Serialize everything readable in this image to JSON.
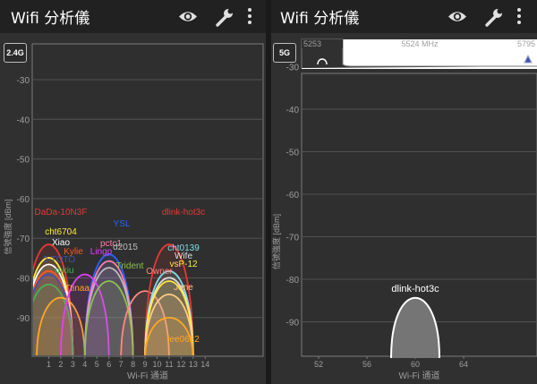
{
  "app": {
    "title": "Wifi 分析儀"
  },
  "left_panel": {
    "band_label": "2.4G",
    "y_axis_title": "信號強度 [dBm]",
    "x_axis_title": "Wi-Fi 通道",
    "y_ticks": [
      "-30",
      "-40",
      "-50",
      "-60",
      "-70",
      "-80",
      "-90"
    ],
    "x_ticks": [
      "1",
      "2",
      "3",
      "4",
      "5",
      "6",
      "7",
      "8",
      "9",
      "10",
      "11",
      "12",
      "13",
      "14"
    ],
    "networks": [
      {
        "name": "DaDa-10N3F",
        "channel": 1,
        "dbm": -66,
        "color": "#e53935"
      },
      {
        "name": "cht6704",
        "channel": 1,
        "dbm": -70,
        "color": "#ffeb3b"
      },
      {
        "name": "Xiao",
        "channel": 1,
        "dbm": -72,
        "color": "#ffffff"
      },
      {
        "name": "Kylie",
        "channel": 1,
        "dbm": -74,
        "color": "#ff5722"
      },
      {
        "name": "2-TOTO",
        "channel": 1,
        "dbm": -75,
        "color": "#3f51b5"
      },
      {
        "name": "mkiu",
        "channel": 1,
        "dbm": -78,
        "color": "#4caf50"
      },
      {
        "name": "Ttinaa",
        "channel": 2,
        "dbm": -82,
        "color": "#ffa726"
      },
      {
        "name": "YSL",
        "channel": 6,
        "dbm": -69,
        "color": "#2962ff"
      },
      {
        "name": "pctc1",
        "channel": 6,
        "dbm": -71,
        "color": "#ff80ab"
      },
      {
        "name": "d2015",
        "channel": 6,
        "dbm": -73,
        "color": "#bdbdbd"
      },
      {
        "name": "Lingp",
        "channel": 4,
        "dbm": -75,
        "color": "#e040fb"
      },
      {
        "name": "Trident",
        "channel": 6,
        "dbm": -77,
        "color": "#8bc34a"
      },
      {
        "name": "Owner",
        "channel": 9,
        "dbm": -80,
        "color": "#ff8a80"
      },
      {
        "name": "dlink-hot3c",
        "channel": 11,
        "dbm": -66,
        "color": "#e53935"
      },
      {
        "name": "cht0139",
        "channel": 11,
        "dbm": -74,
        "color": "#80deea"
      },
      {
        "name": "Wife",
        "channel": 11,
        "dbm": -76,
        "color": "#e0e0e0"
      },
      {
        "name": "vsP-12",
        "channel": 11,
        "dbm": -77,
        "color": "#ffeb3b"
      },
      {
        "name": "Jane",
        "channel": 11,
        "dbm": -81,
        "color": "#ffcc80"
      },
      {
        "name": "lee0622",
        "channel": 11,
        "dbm": -88,
        "color": "#ffa726"
      }
    ]
  },
  "right_panel": {
    "band_label": "5G",
    "y_axis_title": "信號強度 [dBm]",
    "x_axis_title": "Wi-Fi 通道",
    "y_ticks": [
      "-30",
      "-40",
      "-50",
      "-60",
      "-70",
      "-80",
      "-90"
    ],
    "x_ticks": [
      "52",
      "56",
      "60",
      "64"
    ],
    "freq_range": {
      "start": "5253",
      "center": "5524 MHz",
      "end": "5795"
    },
    "networks": [
      {
        "name": "dlink-hot3c",
        "channel": 60,
        "dbm": -84,
        "color": "#ffffff"
      }
    ]
  },
  "icons": [
    "eye-icon",
    "wrench-icon",
    "more-vert-icon"
  ]
}
